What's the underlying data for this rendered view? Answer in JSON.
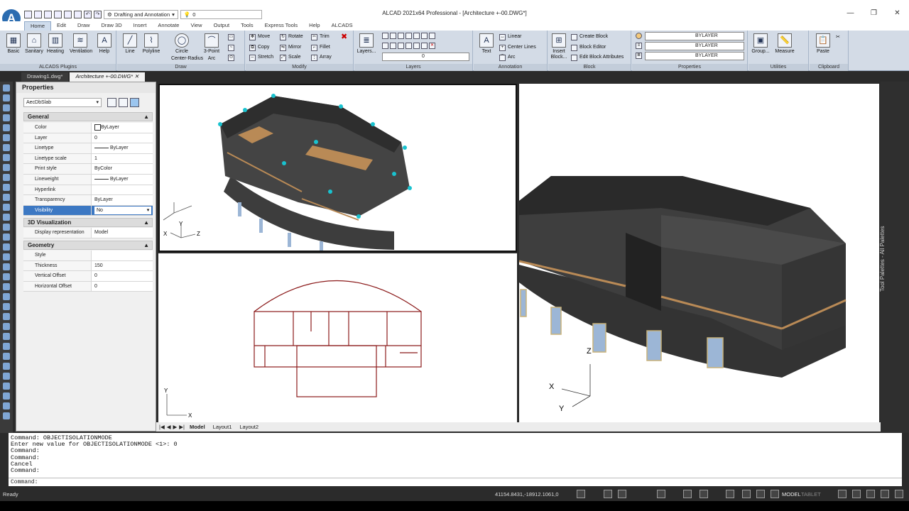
{
  "window": {
    "title": "ALCAD 2021x64 Professional  - [Architecture +-00.DWG*]",
    "minimize": "—",
    "restore": "❐",
    "close": "✕"
  },
  "app_logo": "A",
  "qat": {
    "workspace": "Drafting and Annotation",
    "layer_value": "0"
  },
  "ribbon_tabs": [
    "Home",
    "Edit",
    "Draw",
    "Draw 3D",
    "Insert",
    "Annotate",
    "View",
    "Output",
    "Tools",
    "Express Tools",
    "Help",
    "ALCADS"
  ],
  "active_tab": "Home",
  "ribbon": {
    "plugins": {
      "buttons": [
        "Basic",
        "Sanitary",
        "Heating",
        "Ventilation",
        "Help"
      ],
      "footer": "ALCADS Plugins"
    },
    "draw": {
      "buttons": [
        "Line",
        "Polyline",
        "Circle",
        "3-Point"
      ],
      "circle_sub": "Center-Radius",
      "arc_sub": "Arc",
      "footer": "Draw"
    },
    "modify": {
      "items": [
        "Move",
        "Rotate",
        "Trim",
        "Copy",
        "Mirror",
        "Fillet",
        "Stretch",
        "Scale",
        "Array"
      ],
      "footer": "Modify"
    },
    "layers": {
      "button": "Layers...",
      "footer": "Layers",
      "current": "0"
    },
    "annotation": {
      "text": "Text",
      "items": [
        "Linear",
        "Center Lines",
        "Arc"
      ],
      "footer": "Annotation"
    },
    "block": {
      "insert": "Insert Block...",
      "items": [
        "Create Block",
        "Block Editor",
        "Edit Block Attributes"
      ],
      "footer": "Block"
    },
    "properties": {
      "values": [
        "BYLAYER",
        "BYLAYER",
        "BYLAYER"
      ],
      "footer": "Properties"
    },
    "utilities": {
      "items": [
        "Group...",
        "Measure"
      ],
      "footer": "Utilities"
    },
    "clipboard": {
      "paste": "Paste",
      "footer": "Clipboard"
    }
  },
  "file_tabs": [
    "Drawing1.dwg*",
    "Architecture +-00.DWG*"
  ],
  "properties": {
    "title": "Properties",
    "object_type": "AecDbSlab",
    "groups": {
      "general": "General",
      "viz": "3D Visualization",
      "geometry": "Geometry"
    },
    "general_rows": [
      {
        "k": "Color",
        "v": "ByLayer"
      },
      {
        "k": "Layer",
        "v": "0"
      },
      {
        "k": "Linetype",
        "v": "ByLayer"
      },
      {
        "k": "Linetype scale",
        "v": "1"
      },
      {
        "k": "Print style",
        "v": "ByColor"
      },
      {
        "k": "Lineweight",
        "v": "ByLayer"
      },
      {
        "k": "Hyperlink",
        "v": ""
      },
      {
        "k": "Transparency",
        "v": "ByLayer"
      },
      {
        "k": "Visibility",
        "v": "No"
      }
    ],
    "viz_rows": [
      {
        "k": "Display representation",
        "v": "Model"
      }
    ],
    "geometry_rows": [
      {
        "k": "Style",
        "v": ""
      },
      {
        "k": "Thickness",
        "v": "150"
      },
      {
        "k": "Vertical Offset",
        "v": "0"
      },
      {
        "k": "Horizontal Offset",
        "v": "0"
      }
    ]
  },
  "layout_tabs": [
    "Model",
    "Layout1",
    "Layout2"
  ],
  "tool_palettes_label": "Tool Palettes - All Palettes",
  "axes": {
    "x": "X",
    "y": "Y",
    "z": "Z"
  },
  "command_history": [
    "Command: OBJECTISOLATIONMODE",
    "Enter new value for OBJECTISOLATIONMODE <1>: 0",
    "Command:",
    "Command:",
    "Cancel",
    "Command:"
  ],
  "command_prompt": "Command:",
  "status": {
    "ready": "Ready",
    "coords": "41154.8431,-18912.1061,0",
    "model": "MODEL",
    "tablet": "TABLET"
  },
  "colors": {
    "accent": "#3c78c3",
    "wall": "#3d3d3d",
    "floor": "#b98a56",
    "plan_line": "#8b1a1a"
  }
}
